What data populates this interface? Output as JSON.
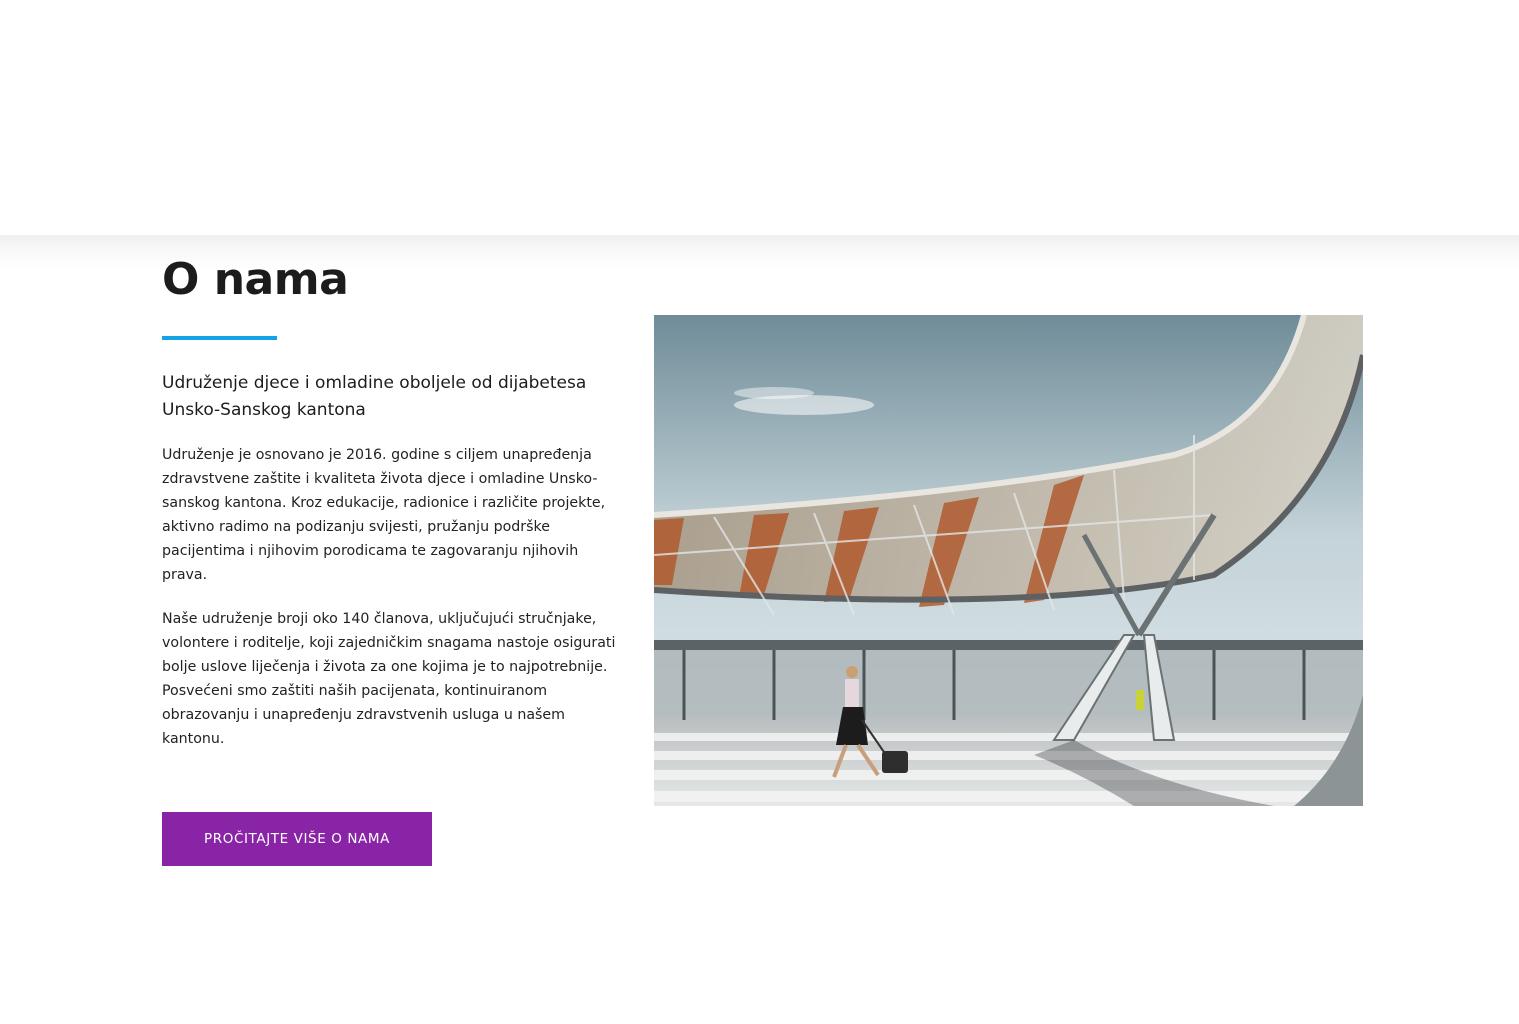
{
  "about": {
    "title": "O nama",
    "subtitle": "Udruženje djece i omladine oboljele od dijabetesa Unsko-Sanskog kantona",
    "paragraph_1": "Udruženje je osnovano je 2016. godine s ciljem unapređenja zdravstvene zaštite i kvaliteta života djece i omladine Unsko-sanskog kantona. Kroz edukacije, radionice i različite projekte, aktivno radimo na podizanju svijesti, pružanju podrške pacijentima i njihovim porodicama te zagovaranju njihovih prava.",
    "paragraph_2": "Naše udruženje broji oko 140 članova, uključujući stručnjake, volontere i roditelje, koji zajedničkim snagama nastoje osigurati bolje uslove liječenja i života za one kojima je to najpotrebnije. Posvećeni smo zaštiti naših pacijenata, kontinuiranom obrazovanju i unapređenju zdravstvenih usluga u našem kantonu.",
    "cta_label": "PROČITAJTE VIŠE O NAMA"
  },
  "colors": {
    "accent_underline": "#15a3e6",
    "button_background": "#8a24a6",
    "button_text": "#ffffff",
    "heading_text": "#1c1c1c"
  },
  "image": {
    "subject": "airport-canopy-photo"
  }
}
